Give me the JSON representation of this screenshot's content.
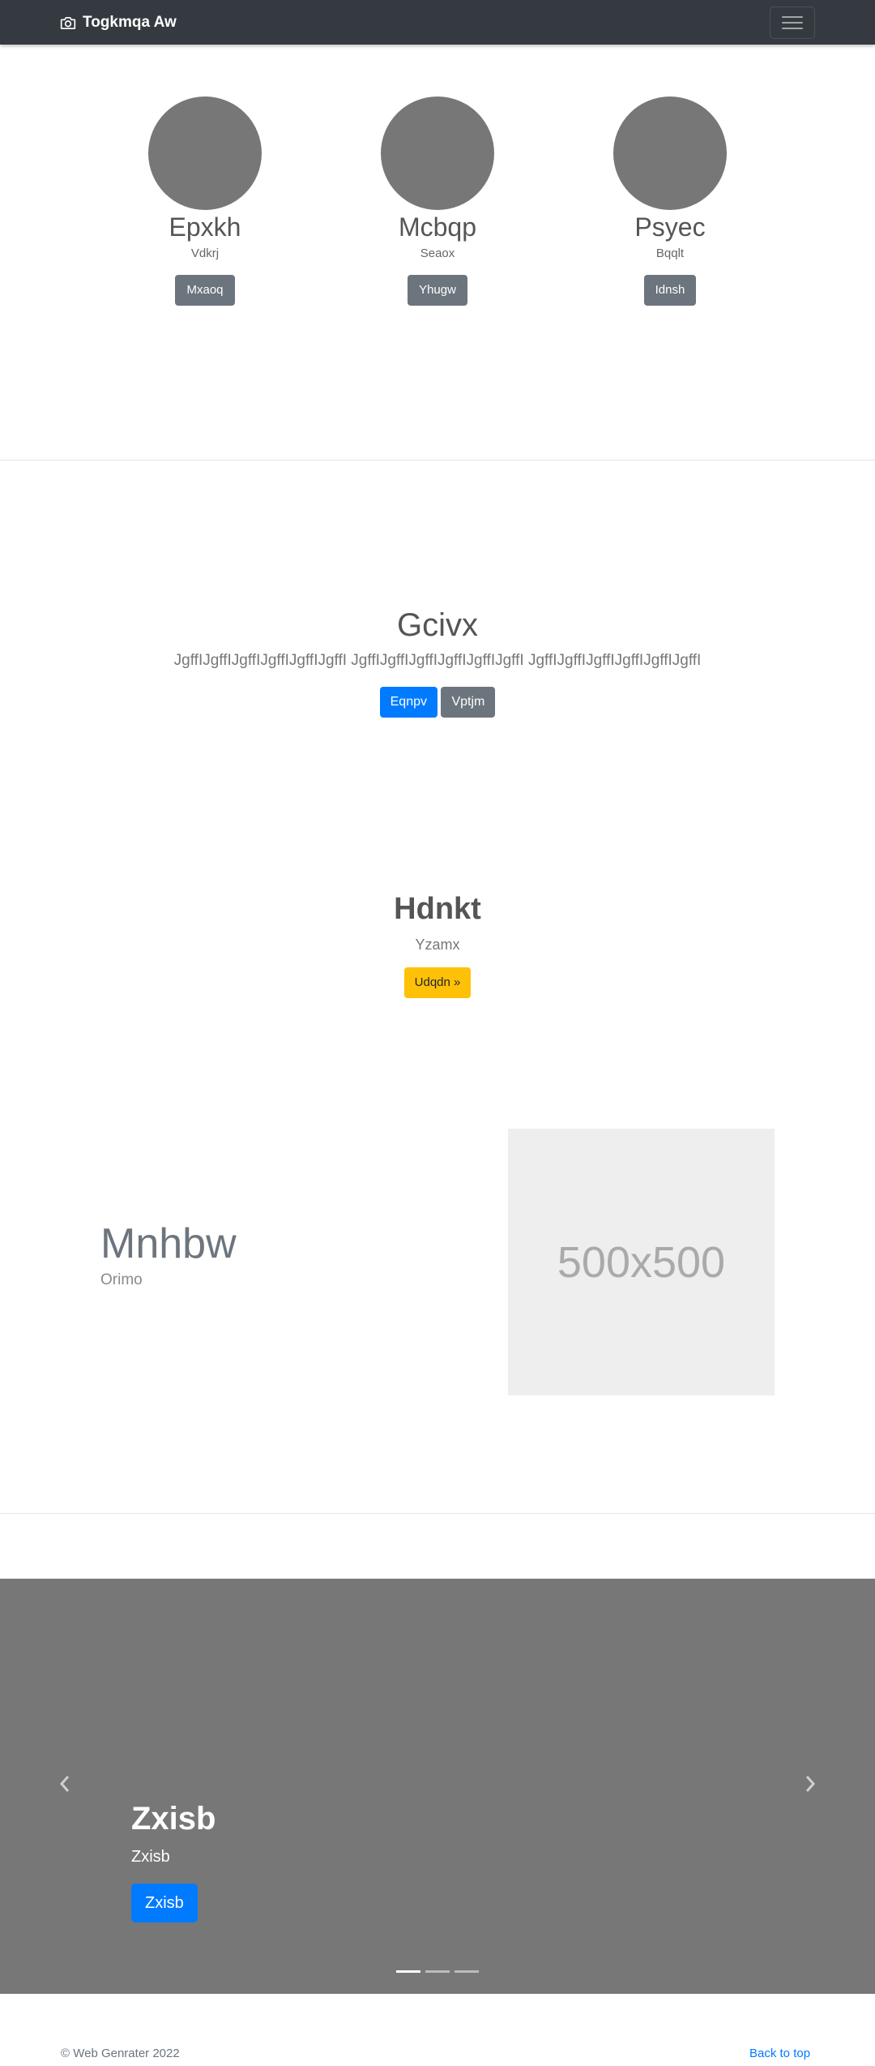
{
  "navbar": {
    "brand": "Togkmqa Aw",
    "brand_icon": "camera-icon",
    "toggler_icon": "hamburger-menu-icon"
  },
  "profiles": [
    {
      "name": "Epxkh",
      "subtitle": "Vdkrj",
      "button": "Mxaoq"
    },
    {
      "name": "Mcbqp",
      "subtitle": "Seaox",
      "button": "Yhugw"
    },
    {
      "name": "Psyec",
      "subtitle": "Bqqlt",
      "button": "Idnsh"
    }
  ],
  "jumbotron": {
    "title": "Gcivx",
    "lead": "JgffIJgffIJgffIJgffIJgffIJgffI JgffIJgffIJgffIJgffIJgffIJgffI JgffIJgffIJgffIJgffIJgffIJgffI",
    "primary_button": "Eqnpv",
    "secondary_button": "Vptjm"
  },
  "cta": {
    "title": "Hdnkt",
    "subtitle": "Yzamx",
    "button": "Udqdn »"
  },
  "feature": {
    "title": "Mnhbw",
    "subtitle": "Orimo",
    "image_label": "500x500"
  },
  "carousel": {
    "title": "Zxisb",
    "subtitle": "Zxisb",
    "button": "Zxisb",
    "prev_icon": "chevron-left-icon",
    "next_icon": "chevron-right-icon",
    "slide_count": 3,
    "active_slide": 1
  },
  "footer": {
    "copyright": "© Web Genrater 2022",
    "back_to_top": "Back to top"
  },
  "colors": {
    "navbar_bg": "#343a40",
    "primary": "#007bff",
    "secondary": "#6c757d",
    "warning": "#ffc107",
    "avatar": "#777777",
    "carousel_bg": "#777777"
  }
}
